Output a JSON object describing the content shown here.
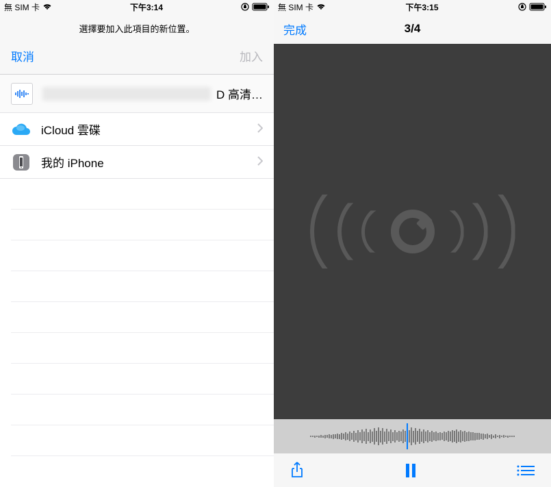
{
  "left": {
    "status": {
      "carrier": "無 SIM 卡",
      "time": "下午3:14"
    },
    "prompt_text": "選擇要加入此項目的新位置。",
    "nav": {
      "cancel": "取消",
      "add": "加入"
    },
    "file": {
      "suffix": "D 高清…"
    },
    "locations": [
      {
        "label": "iCloud 雲碟",
        "icon": "cloud"
      },
      {
        "label": "我的 iPhone",
        "icon": "device"
      }
    ]
  },
  "right": {
    "status": {
      "carrier": "無 SIM 卡",
      "time": "下午3:15"
    },
    "nav": {
      "done": "完成",
      "counter": "3/4"
    }
  },
  "colors": {
    "accent": "#007aff"
  }
}
